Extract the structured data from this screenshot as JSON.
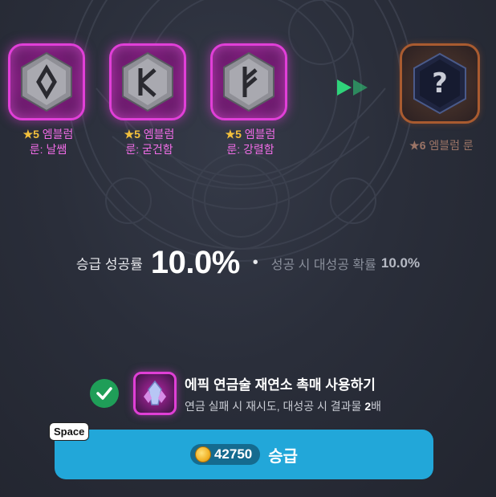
{
  "materials": [
    {
      "stars": "★5",
      "line1": "엠블럼",
      "line2": "룬: 날쌤",
      "icon": "rune-diamond-icon"
    },
    {
      "stars": "★5",
      "line1": "엠블럼",
      "line2": "룬: 굳건함",
      "icon": "rune-kaun-icon"
    },
    {
      "stars": "★5",
      "line1": "엠블럼",
      "line2": "룬: 강렬함",
      "icon": "rune-fehu-icon"
    }
  ],
  "result": {
    "stars": "★6",
    "label": "엠블럼 룬",
    "icon": "mystery-question-icon"
  },
  "rates": {
    "success_label": "승급 성공률",
    "success_value": "10.0%",
    "separator": "•",
    "great_label": "성공 시 대성공 확률",
    "great_value": "10.0%"
  },
  "catalyst": {
    "title": "에픽 연금술 재연소 촉매 사용하기",
    "desc_prefix": "연금 실패 시 재시도, 대성공 시 결과물 ",
    "desc_multiplier": "2",
    "desc_suffix": "배",
    "checked": true
  },
  "shortcut": "Space",
  "upgrade": {
    "cost": "42750",
    "label": "승급"
  },
  "colors": {
    "epic_frame": "#e13fd8",
    "legend_frame": "#a95b30",
    "button": "#22a7d9",
    "check": "#1f9e58",
    "star": "#f3c03c",
    "arrows": "#2fd37a"
  }
}
